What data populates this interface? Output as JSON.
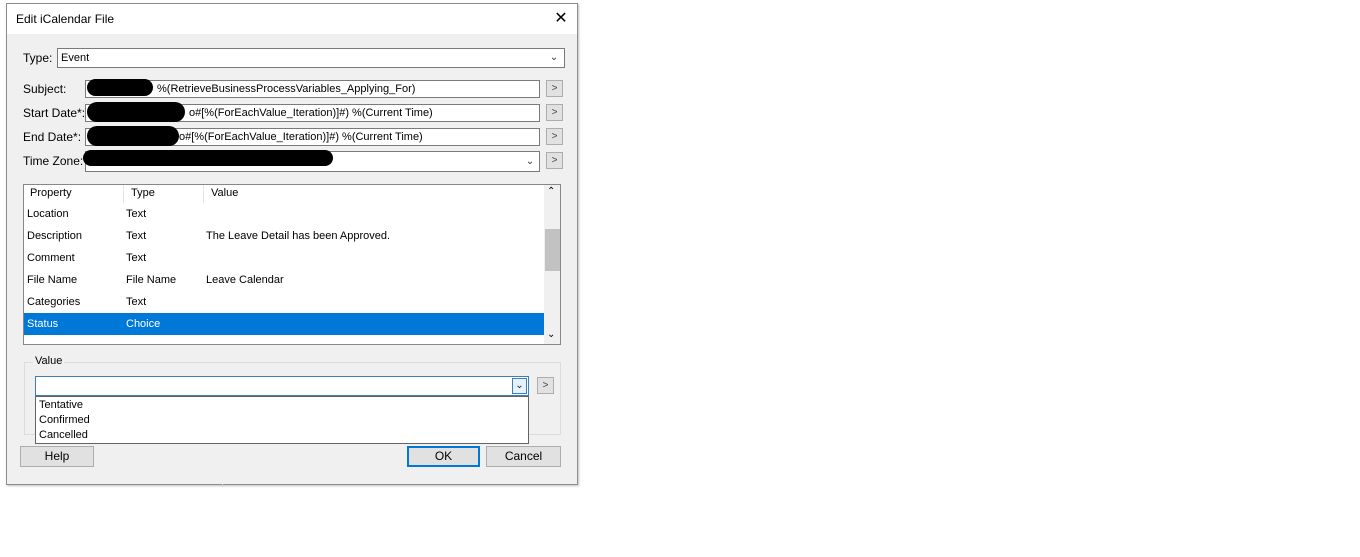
{
  "window": {
    "title": "Edit  iCalendar File",
    "close_glyph": "✕"
  },
  "form": {
    "type_label": "Type:",
    "type_value": "Event",
    "subject_label": "Subject:",
    "subject_value": "%(RetrieveBusinessProcessVariables_Applying_For)",
    "start_label": "Start Date*:",
    "start_value": "o#[%(ForEachValue_Iteration)]#) %(Current Time)",
    "end_label": "End Date*:",
    "end_value": "o#[%(ForEachValue_Iteration)]#) %(Current Time)",
    "timezone_label": "Time Zone:",
    "more_glyph": ">"
  },
  "grid": {
    "columns": [
      "Property",
      "Type",
      "Value"
    ],
    "rows": [
      {
        "property": "Location",
        "type": "Text",
        "value": ""
      },
      {
        "property": "Description",
        "type": "Text",
        "value": "The Leave Detail has been Approved."
      },
      {
        "property": "Comment",
        "type": "Text",
        "value": ""
      },
      {
        "property": "File Name",
        "type": "File Name",
        "value": "Leave Calendar"
      },
      {
        "property": "Categories",
        "type": "Text",
        "value": ""
      },
      {
        "property": "Status",
        "type": "Choice",
        "value": ""
      }
    ],
    "selected_index": 5
  },
  "value_group": {
    "label": "Value",
    "options": [
      "Tentative",
      "Confirmed",
      "Cancelled"
    ]
  },
  "buttons": {
    "help": "Help",
    "ok": "OK",
    "cancel": "Cancel"
  },
  "colors": {
    "selection": "#0078d7",
    "dialog_bg": "#f0f0f0"
  }
}
